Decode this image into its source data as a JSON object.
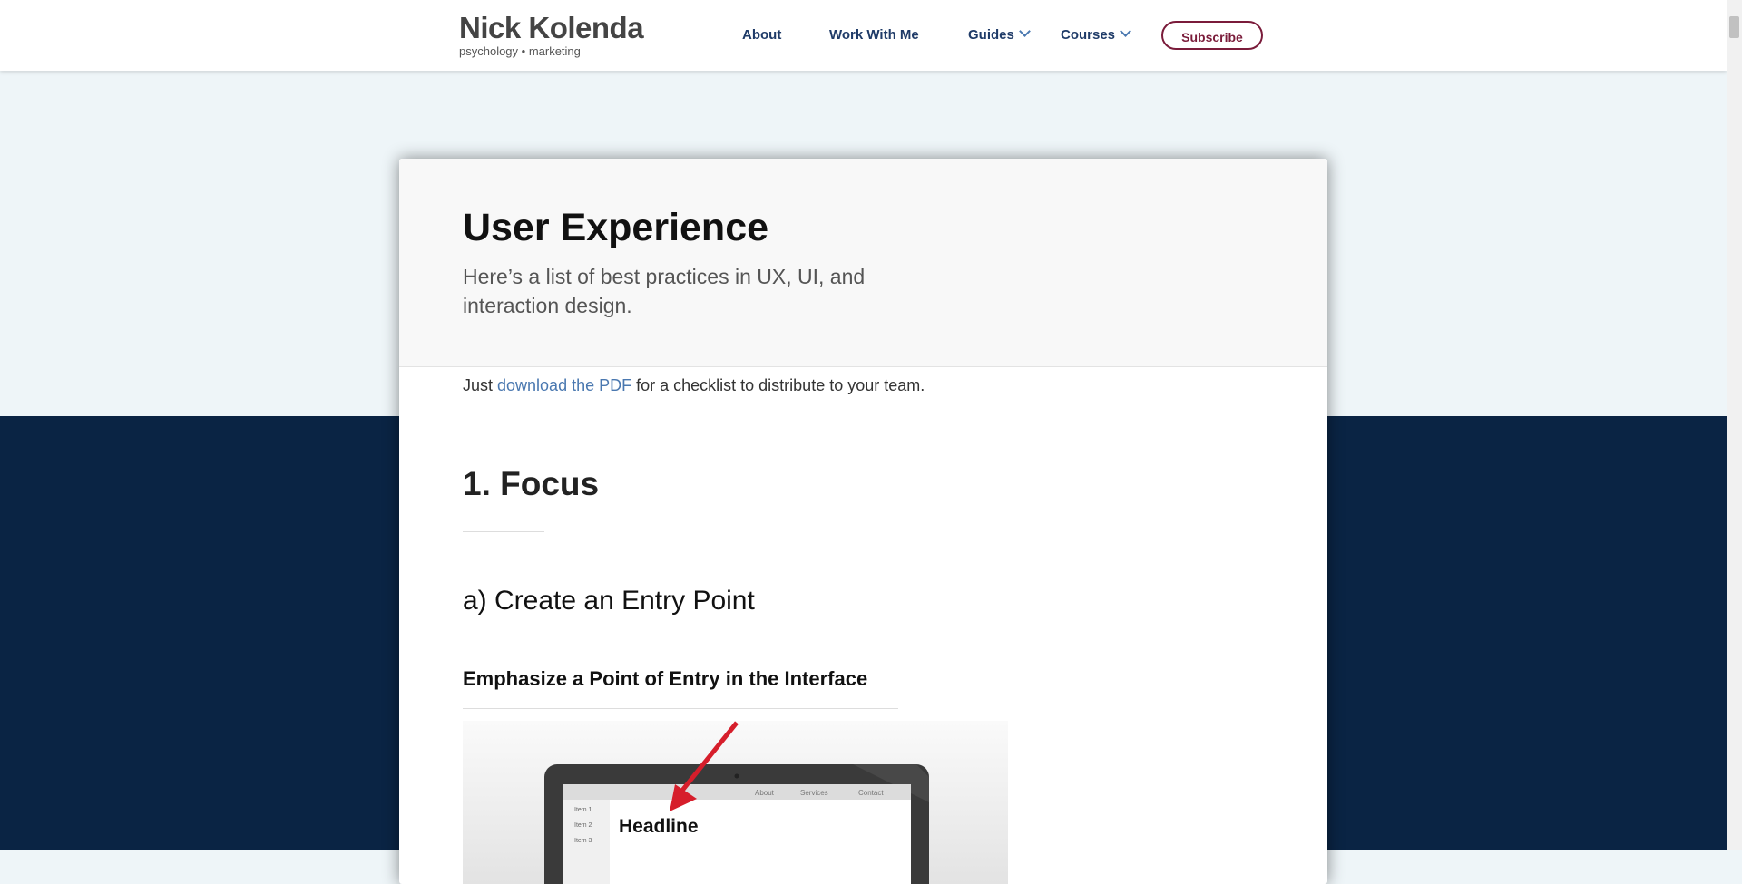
{
  "header": {
    "brand_name": "Nick Kolenda",
    "brand_tagline": "psychology • marketing",
    "nav": [
      "About",
      "Work With Me",
      "Guides",
      "Courses"
    ],
    "subscribe_label": "Subscribe"
  },
  "hero": {
    "title": "User Experience",
    "subtitle": "Here’s a list of best practices in UX, UI, and interaction design."
  },
  "intro": {
    "prefix": "Just ",
    "link": "download the PDF",
    "suffix": " for a checklist to distribute to your team."
  },
  "content": {
    "section_title": "1. Focus",
    "subsection_title": "a) Create an Entry Point",
    "heading": "Emphasize a Point of Entry in the Interface"
  },
  "illustration": {
    "nav_items": [
      "About",
      "Services",
      "Contact"
    ],
    "side_items": [
      "Item 1",
      "Item 2",
      "Item 3"
    ],
    "headline": "Headline"
  }
}
